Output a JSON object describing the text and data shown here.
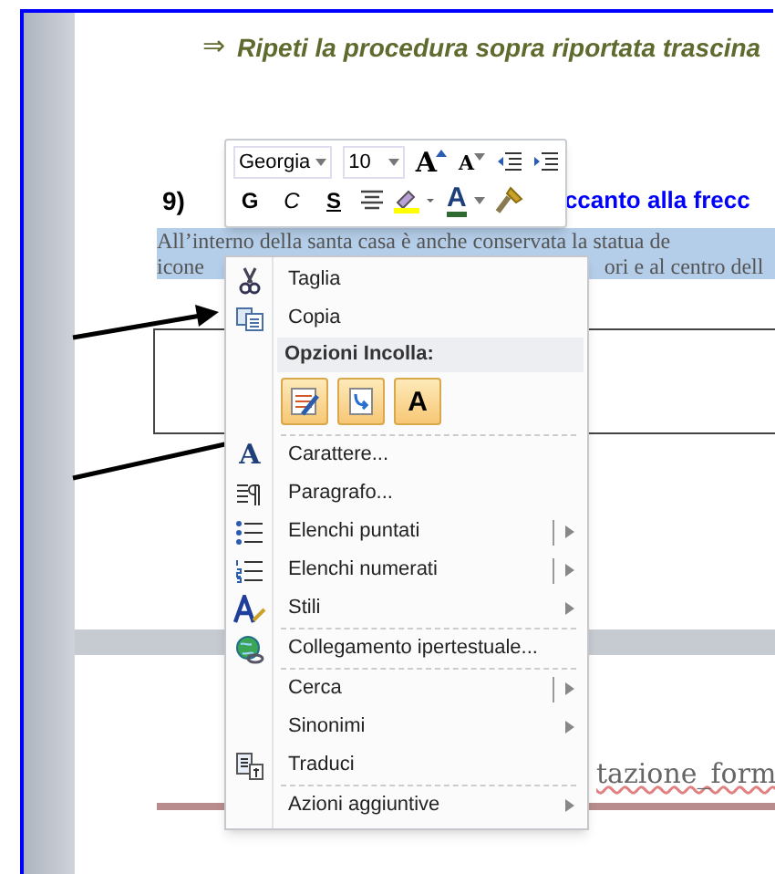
{
  "document": {
    "bullet_arrow": "⇒",
    "instruction": "Ripeti la procedura sopra riportata trascina",
    "step_number": "9)",
    "heading": "ccanto alla frecc",
    "body_lines": [
      "All’interno della santa casa è anche conservata la statua de",
      "icone",
      "ori e al centro dell"
    ],
    "page2_text": "tazione_form"
  },
  "mini_toolbar": {
    "font": "Georgia",
    "size": "10",
    "row1": [
      {
        "kind": "grow",
        "label": "A"
      },
      {
        "kind": "shrink",
        "label": "A"
      },
      {
        "kind": "outdent"
      },
      {
        "kind": "indent"
      }
    ],
    "row2": [
      {
        "kind": "bold",
        "label": "G"
      },
      {
        "kind": "italic",
        "label": "C"
      },
      {
        "kind": "underline",
        "label": "S"
      },
      {
        "kind": "center"
      },
      {
        "kind": "highlight"
      },
      {
        "kind": "fontcolor",
        "label": "A"
      },
      {
        "kind": "painter"
      }
    ]
  },
  "context_menu": {
    "items": [
      {
        "kind": "item",
        "label": "Taglia",
        "submenu": false,
        "split": false,
        "separator_before": false
      },
      {
        "kind": "item",
        "label": "Copia",
        "submenu": false,
        "split": false,
        "separator_before": false
      },
      {
        "kind": "header",
        "label": "Opzioni Incolla:"
      },
      {
        "kind": "paste",
        "options": [
          {
            "kind": "keep"
          },
          {
            "kind": "merge"
          },
          {
            "kind": "text",
            "label": "A"
          }
        ]
      },
      {
        "kind": "item",
        "icon_text": "A",
        "label": "Carattere...",
        "submenu": false,
        "split": false,
        "separator_before": true
      },
      {
        "kind": "item",
        "label": "Paragrafo...",
        "submenu": false,
        "split": false,
        "separator_before": false
      },
      {
        "kind": "item",
        "label": "Elenchi puntati",
        "submenu": true,
        "split": true,
        "separator_before": false
      },
      {
        "kind": "item",
        "label": "Elenchi numerati",
        "submenu": true,
        "split": true,
        "separator_before": false
      },
      {
        "kind": "item",
        "label": "Stili",
        "submenu": true,
        "split": false,
        "separator_before": false
      },
      {
        "kind": "item",
        "label": "Collegamento ipertestuale...",
        "submenu": false,
        "split": false,
        "separator_before": true
      },
      {
        "kind": "item",
        "label": "Cerca",
        "submenu": true,
        "split": true,
        "separator_before": true
      },
      {
        "kind": "item",
        "label": "Sinonimi",
        "submenu": true,
        "split": false,
        "separator_before": false
      },
      {
        "kind": "item",
        "label": "Traduci",
        "submenu": false,
        "split": false,
        "separator_before": false
      },
      {
        "kind": "item",
        "label": "Azioni aggiuntive",
        "submenu": true,
        "split": false,
        "separator_before": true
      }
    ]
  }
}
